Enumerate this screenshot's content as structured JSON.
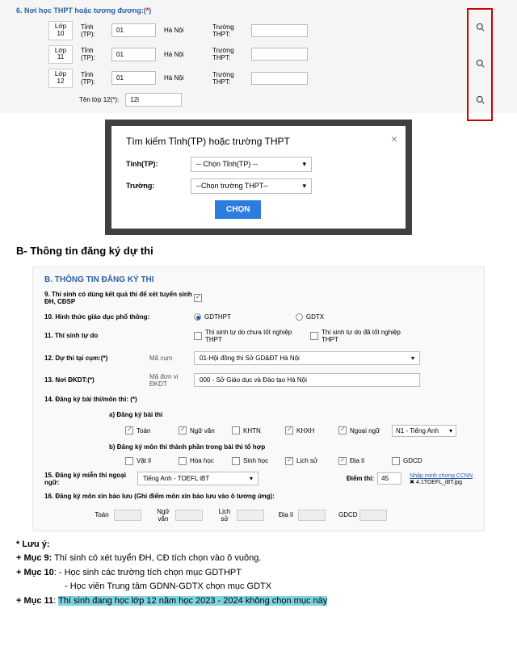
{
  "section6": {
    "title": "6. Nơi học THPT hoặc tương đương:",
    "grades": [
      {
        "g1": "Lớp",
        "g2": "10",
        "lbl": "Tỉnh (TP):",
        "val": "01",
        "city": "Hà Nội",
        "schLbl": "Trường THPT:"
      },
      {
        "g1": "Lớp",
        "g2": "11",
        "lbl": "Tỉnh (TP):",
        "val": "01",
        "city": "Hà Nội",
        "schLbl": "Trường THPT:"
      },
      {
        "g1": "Lớp",
        "g2": "12",
        "lbl": "Tỉnh (TP):",
        "val": "01",
        "city": "Hà Nội",
        "schLbl": "Trường THPT:"
      }
    ],
    "tenlop_lbl": "Tên lớp 12(*):",
    "tenlop_val": "12i"
  },
  "modal": {
    "title": "Tìm kiếm Tỉnh(TP) hoặc trường THPT",
    "tinh_lbl": "Tỉnh(TP):",
    "tinh_val": "-- Chọn Tỉnh(TP) --",
    "truong_lbl": "Trường:",
    "truong_val": "--Chọn trường THPT--",
    "btn": "CHỌN"
  },
  "headingB": "B- Thông tin đăng ký dự thi",
  "sectionB": {
    "title": "B. THÔNG TIN ĐĂNG KÝ THI",
    "q9": "9. Thí sinh có dùng kết quả thi để xét tuyển sinh ĐH, CĐSP",
    "q10": "10. Hình thức giáo dục phổ thông:",
    "q10a": "GDTHPT",
    "q10b": "GDTX",
    "q11": "11. Thí sinh tự do",
    "q11a": "Thí sinh tự do chưa tốt nghiệp THPT",
    "q11b": "Thí sinh tự do đã tốt nghiệp THPT",
    "q12": "12. Dự thi tại cụm:(*)",
    "q12_sub": "Mã cụm",
    "q12_val": "01-Hội đồng thi Sở GD&ĐT Hà Nội",
    "q13": "13. Nơi ĐKDT:(*)",
    "q13_sub": "Mã đơn vị ĐKDT",
    "q13_val": "000 - Sở Giáo dục và Đào tạo Hà Nội",
    "q14": "14. Đăng ký bài thi/môn thi: (*)",
    "q14a": "a) Đăng ký bài thi",
    "subjects_a": [
      "Toán",
      "Ngữ văn",
      "KHTN",
      "KHXH",
      "Ngoại ngữ"
    ],
    "n1_val": "N1 - Tiếng Anh",
    "q14b": "b) Đăng ký môn thi thành phần trong bài thi tổ hợp",
    "subjects_b": [
      "Vật lí",
      "Hóa học",
      "Sinh học",
      "Lịch sử",
      "Địa lí",
      "GDCD"
    ],
    "q15": "15. Đăng ký miễn thi ngoại ngữ:",
    "q15_val": "Tiếng Anh - TOEFL iBT",
    "q15_score_lbl": "Điểm thi:",
    "q15_score": "45",
    "q15_link": "Nhập minh chứng CCNN",
    "q15_file": "4.1TOEFL_iBT.jpg",
    "q16": "16. Đăng ký môn xin bảo lưu (Ghi điểm môn xin bảo lưu vào ô tương ứng):",
    "subjects_16": [
      "Toán",
      "Ngữ văn",
      "Lịch sử",
      "Địa lí",
      "GDCD"
    ]
  },
  "notes": {
    "t1": "* Lưu ý:",
    "t2a": "+ Mục 9:",
    "t2b": " Thí sinh có xét tuyển ĐH, CĐ tích chọn vào ô vuông.",
    "t3a": "+ Mục 10",
    "t3b": ": - Học sinh các trường tích chọn mục GDTHPT",
    "t4": "- Học viên Trung tâm GDNN-GDTX chọn mục GDTX",
    "t5a": "+ Mục 11",
    "t5b": ": ",
    "t5c": "Thí sinh đang học lớp 12 năm học 2023 - 2024 không chọn mục này"
  }
}
